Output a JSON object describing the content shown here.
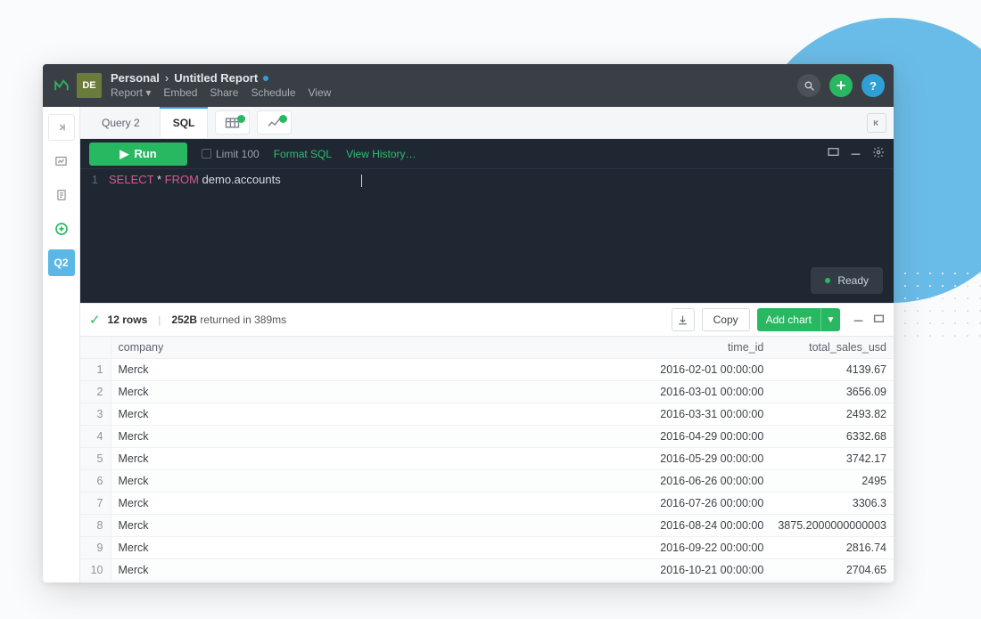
{
  "header": {
    "user_badge": "DE",
    "breadcrumb_workspace": "Personal",
    "breadcrumb_sep": "›",
    "breadcrumb_report": "Untitled Report",
    "menu": {
      "report": "Report",
      "embed": "Embed",
      "share": "Share",
      "schedule": "Schedule",
      "view": "View"
    }
  },
  "sidebar": {
    "q2": "Q2"
  },
  "tabs": {
    "query": "Query 2",
    "sql": "SQL"
  },
  "editor": {
    "run": "Run",
    "limit": "Limit 100",
    "format": "Format SQL",
    "history": "View History…",
    "line_no": "1",
    "kw_select": "SELECT",
    "star": " * ",
    "kw_from": "FROM",
    "table_ref": " demo.accounts",
    "ready": "Ready"
  },
  "results": {
    "rows_label": "12 rows",
    "size": "252B",
    "returned_in": " returned in 389ms",
    "copy": "Copy",
    "add_chart": "Add chart"
  },
  "columns": {
    "company": "company",
    "time_id": "time_id",
    "total_sales_usd": "total_sales_usd"
  },
  "rows": [
    {
      "n": "1",
      "company": "Merck",
      "time_id": "2016-02-01 00:00:00",
      "total_sales_usd": "4139.67"
    },
    {
      "n": "2",
      "company": "Merck",
      "time_id": "2016-03-01 00:00:00",
      "total_sales_usd": "3656.09"
    },
    {
      "n": "3",
      "company": "Merck",
      "time_id": "2016-03-31 00:00:00",
      "total_sales_usd": "2493.82"
    },
    {
      "n": "4",
      "company": "Merck",
      "time_id": "2016-04-29 00:00:00",
      "total_sales_usd": "6332.68"
    },
    {
      "n": "5",
      "company": "Merck",
      "time_id": "2016-05-29 00:00:00",
      "total_sales_usd": "3742.17"
    },
    {
      "n": "6",
      "company": "Merck",
      "time_id": "2016-06-26 00:00:00",
      "total_sales_usd": "2495"
    },
    {
      "n": "7",
      "company": "Merck",
      "time_id": "2016-07-26 00:00:00",
      "total_sales_usd": "3306.3"
    },
    {
      "n": "8",
      "company": "Merck",
      "time_id": "2016-08-24 00:00:00",
      "total_sales_usd": "3875.2000000000003"
    },
    {
      "n": "9",
      "company": "Merck",
      "time_id": "2016-09-22 00:00:00",
      "total_sales_usd": "2816.74"
    },
    {
      "n": "10",
      "company": "Merck",
      "time_id": "2016-10-21 00:00:00",
      "total_sales_usd": "2704.65"
    }
  ]
}
